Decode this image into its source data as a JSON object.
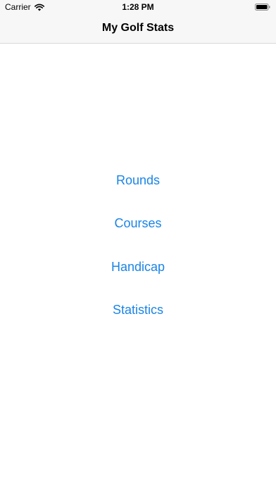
{
  "status_bar": {
    "carrier": "Carrier",
    "time": "1:28 PM",
    "wifi_icon": "wifi-icon",
    "battery_icon": "battery-icon"
  },
  "nav": {
    "title": "My Golf Stats"
  },
  "menu": {
    "items": [
      {
        "label": "Rounds"
      },
      {
        "label": "Courses"
      },
      {
        "label": "Handicap"
      },
      {
        "label": "Statistics"
      }
    ]
  },
  "colors": {
    "link": "#1a84e6",
    "bar_background": "#f7f7f7",
    "text": "#000000"
  }
}
